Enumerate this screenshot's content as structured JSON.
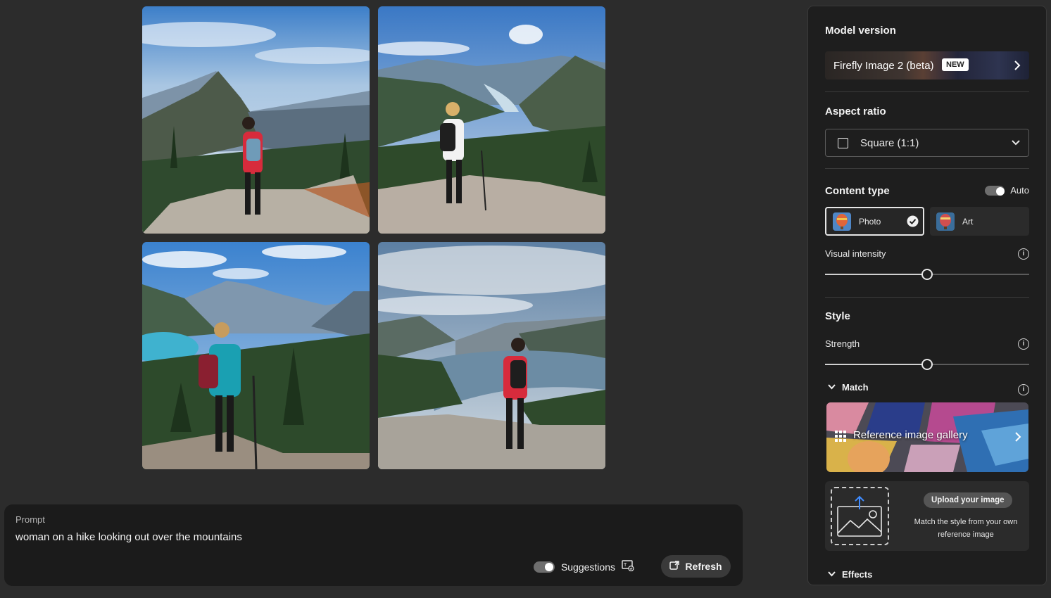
{
  "grid": {
    "images": [
      {
        "label": "generated-image-1"
      },
      {
        "label": "generated-image-2"
      },
      {
        "label": "generated-image-3"
      },
      {
        "label": "generated-image-4"
      }
    ]
  },
  "prompt": {
    "label": "Prompt",
    "value": "woman on a hike looking out over the mountains",
    "suggestions_label": "Suggestions",
    "suggestions_on": true,
    "refresh_label": "Refresh"
  },
  "panel": {
    "model_heading": "Model version",
    "model_name": "Firefly Image 2 (beta)",
    "model_badge": "NEW",
    "aspect_heading": "Aspect ratio",
    "aspect_value": "Square (1:1)",
    "content_heading": "Content type",
    "auto_label": "Auto",
    "auto_on": true,
    "content_options": [
      {
        "label": "Photo",
        "selected": true
      },
      {
        "label": "Art",
        "selected": false
      }
    ],
    "visual_intensity_label": "Visual intensity",
    "visual_intensity_level": 0.5,
    "style_heading": "Style",
    "strength_label": "Strength",
    "strength_level": 0.5,
    "match_label": "Match",
    "gallery_label": "Reference image gallery",
    "upload_button": "Upload your image",
    "upload_desc": "Match the style from your own reference image",
    "effects_label": "Effects"
  },
  "colors": {
    "background": "#2c2c2c",
    "panel": "#1e1e1e",
    "prompt_bar": "#1b1b1b",
    "accent": "#e6e6e6"
  }
}
